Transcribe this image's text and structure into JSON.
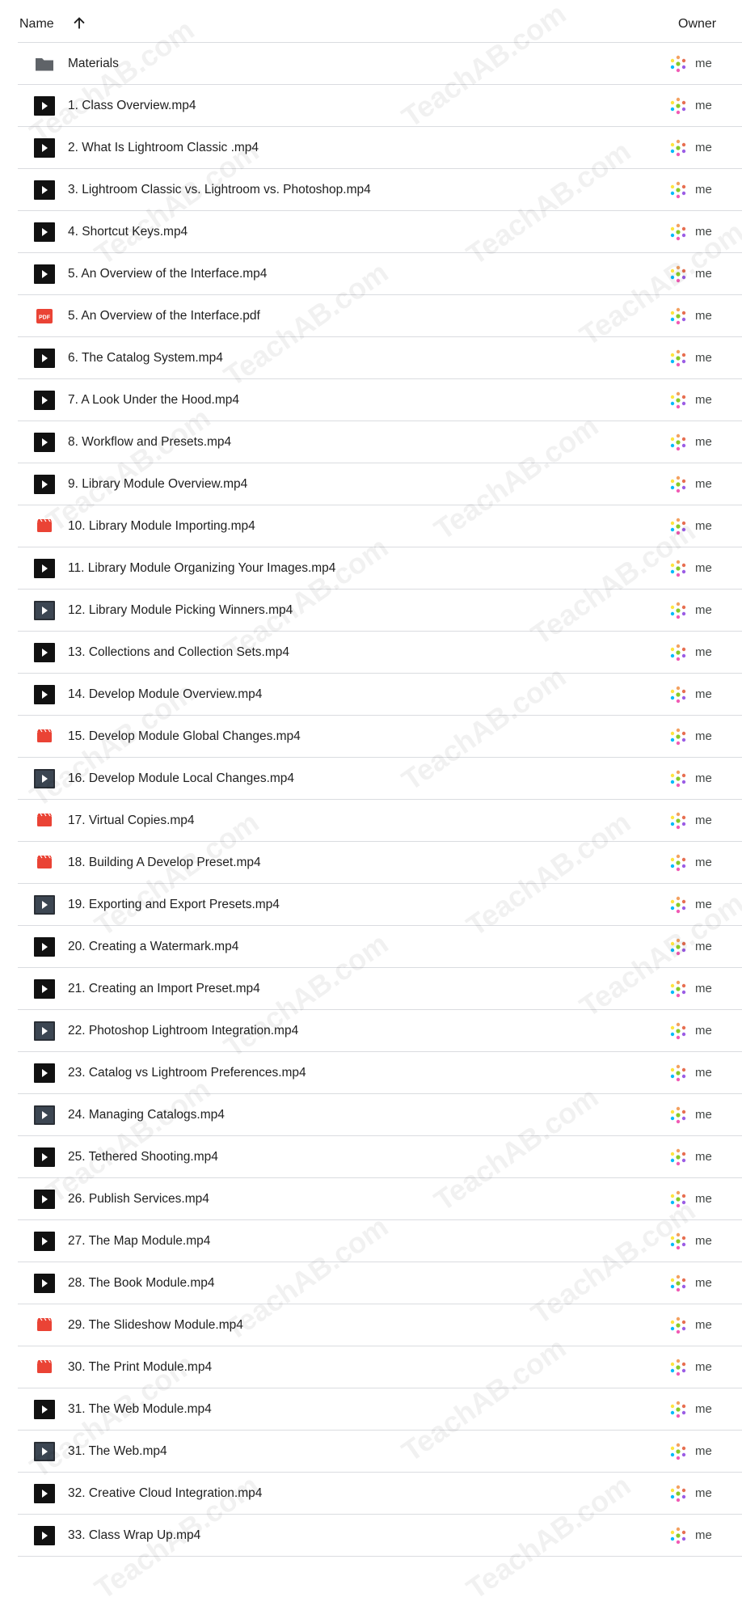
{
  "header": {
    "name_label": "Name",
    "owner_label": "Owner"
  },
  "files": [
    {
      "name": "Materials",
      "icon": "folder-icon",
      "owner": "me"
    },
    {
      "name": "1. Class Overview.mp4",
      "icon": "video-icon",
      "owner": "me"
    },
    {
      "name": "2. What Is Lightroom Classic .mp4",
      "icon": "video-icon",
      "owner": "me"
    },
    {
      "name": "3. Lightroom Classic vs. Lightroom vs. Photoshop.mp4",
      "icon": "video-icon",
      "owner": "me"
    },
    {
      "name": "4. Shortcut Keys.mp4",
      "icon": "video-icon",
      "owner": "me"
    },
    {
      "name": "5. An Overview of the Interface.mp4",
      "icon": "video-icon",
      "owner": "me"
    },
    {
      "name": "5. An Overview of the Interface.pdf",
      "icon": "pdf-icon",
      "owner": "me"
    },
    {
      "name": "6. The Catalog System.mp4",
      "icon": "video-icon",
      "owner": "me"
    },
    {
      "name": "7. A Look Under the Hood.mp4",
      "icon": "video-icon",
      "owner": "me"
    },
    {
      "name": "8. Workflow and Presets.mp4",
      "icon": "video-icon",
      "owner": "me"
    },
    {
      "name": "9. Library Module Overview.mp4",
      "icon": "video-icon",
      "owner": "me"
    },
    {
      "name": "10. Library Module Importing.mp4",
      "icon": "film-icon",
      "owner": "me"
    },
    {
      "name": "11. Library Module Organizing Your Images.mp4",
      "icon": "video-icon",
      "owner": "me"
    },
    {
      "name": "12. Library Module Picking Winners.mp4",
      "icon": "video-thumb-icon",
      "owner": "me"
    },
    {
      "name": "13. Collections and Collection Sets.mp4",
      "icon": "video-icon",
      "owner": "me"
    },
    {
      "name": "14. Develop Module Overview.mp4",
      "icon": "video-icon",
      "owner": "me"
    },
    {
      "name": "15. Develop Module Global Changes.mp4",
      "icon": "film-icon",
      "owner": "me"
    },
    {
      "name": "16. Develop Module Local Changes.mp4",
      "icon": "video-thumb-icon",
      "owner": "me"
    },
    {
      "name": "17. Virtual Copies.mp4",
      "icon": "film-icon",
      "owner": "me"
    },
    {
      "name": "18. Building A Develop Preset.mp4",
      "icon": "film-icon",
      "owner": "me"
    },
    {
      "name": "19. Exporting and Export Presets.mp4",
      "icon": "video-thumb-icon",
      "owner": "me"
    },
    {
      "name": "20. Creating a Watermark.mp4",
      "icon": "video-icon",
      "owner": "me"
    },
    {
      "name": "21. Creating an Import Preset.mp4",
      "icon": "video-icon",
      "owner": "me"
    },
    {
      "name": "22. Photoshop Lightroom Integration.mp4",
      "icon": "video-thumb-icon",
      "owner": "me"
    },
    {
      "name": "23. Catalog vs Lightroom Preferences.mp4",
      "icon": "video-icon",
      "owner": "me"
    },
    {
      "name": "24. Managing Catalogs.mp4",
      "icon": "video-thumb-icon",
      "owner": "me"
    },
    {
      "name": "25. Tethered Shooting.mp4",
      "icon": "video-icon",
      "owner": "me"
    },
    {
      "name": "26. Publish Services.mp4",
      "icon": "video-icon",
      "owner": "me"
    },
    {
      "name": "27. The Map Module.mp4",
      "icon": "video-icon",
      "owner": "me"
    },
    {
      "name": "28. The Book Module.mp4",
      "icon": "video-icon",
      "owner": "me"
    },
    {
      "name": "29. The Slideshow Module.mp4",
      "icon": "film-icon",
      "owner": "me"
    },
    {
      "name": "30. The Print Module.mp4",
      "icon": "film-icon",
      "owner": "me"
    },
    {
      "name": "31. The Web Module.mp4",
      "icon": "video-icon",
      "owner": "me"
    },
    {
      "name": "31. The Web.mp4",
      "icon": "video-thumb-icon",
      "owner": "me"
    },
    {
      "name": "32. Creative Cloud Integration.mp4",
      "icon": "video-icon",
      "owner": "me"
    },
    {
      "name": "33. Class Wrap Up.mp4",
      "icon": "video-icon",
      "owner": "me"
    }
  ],
  "watermark_text": "TeachAB.com",
  "colors": {
    "divider": "#dadce0",
    "folder": "#5f6368",
    "red_icon": "#ea4335",
    "text": "#1f1f1f"
  }
}
